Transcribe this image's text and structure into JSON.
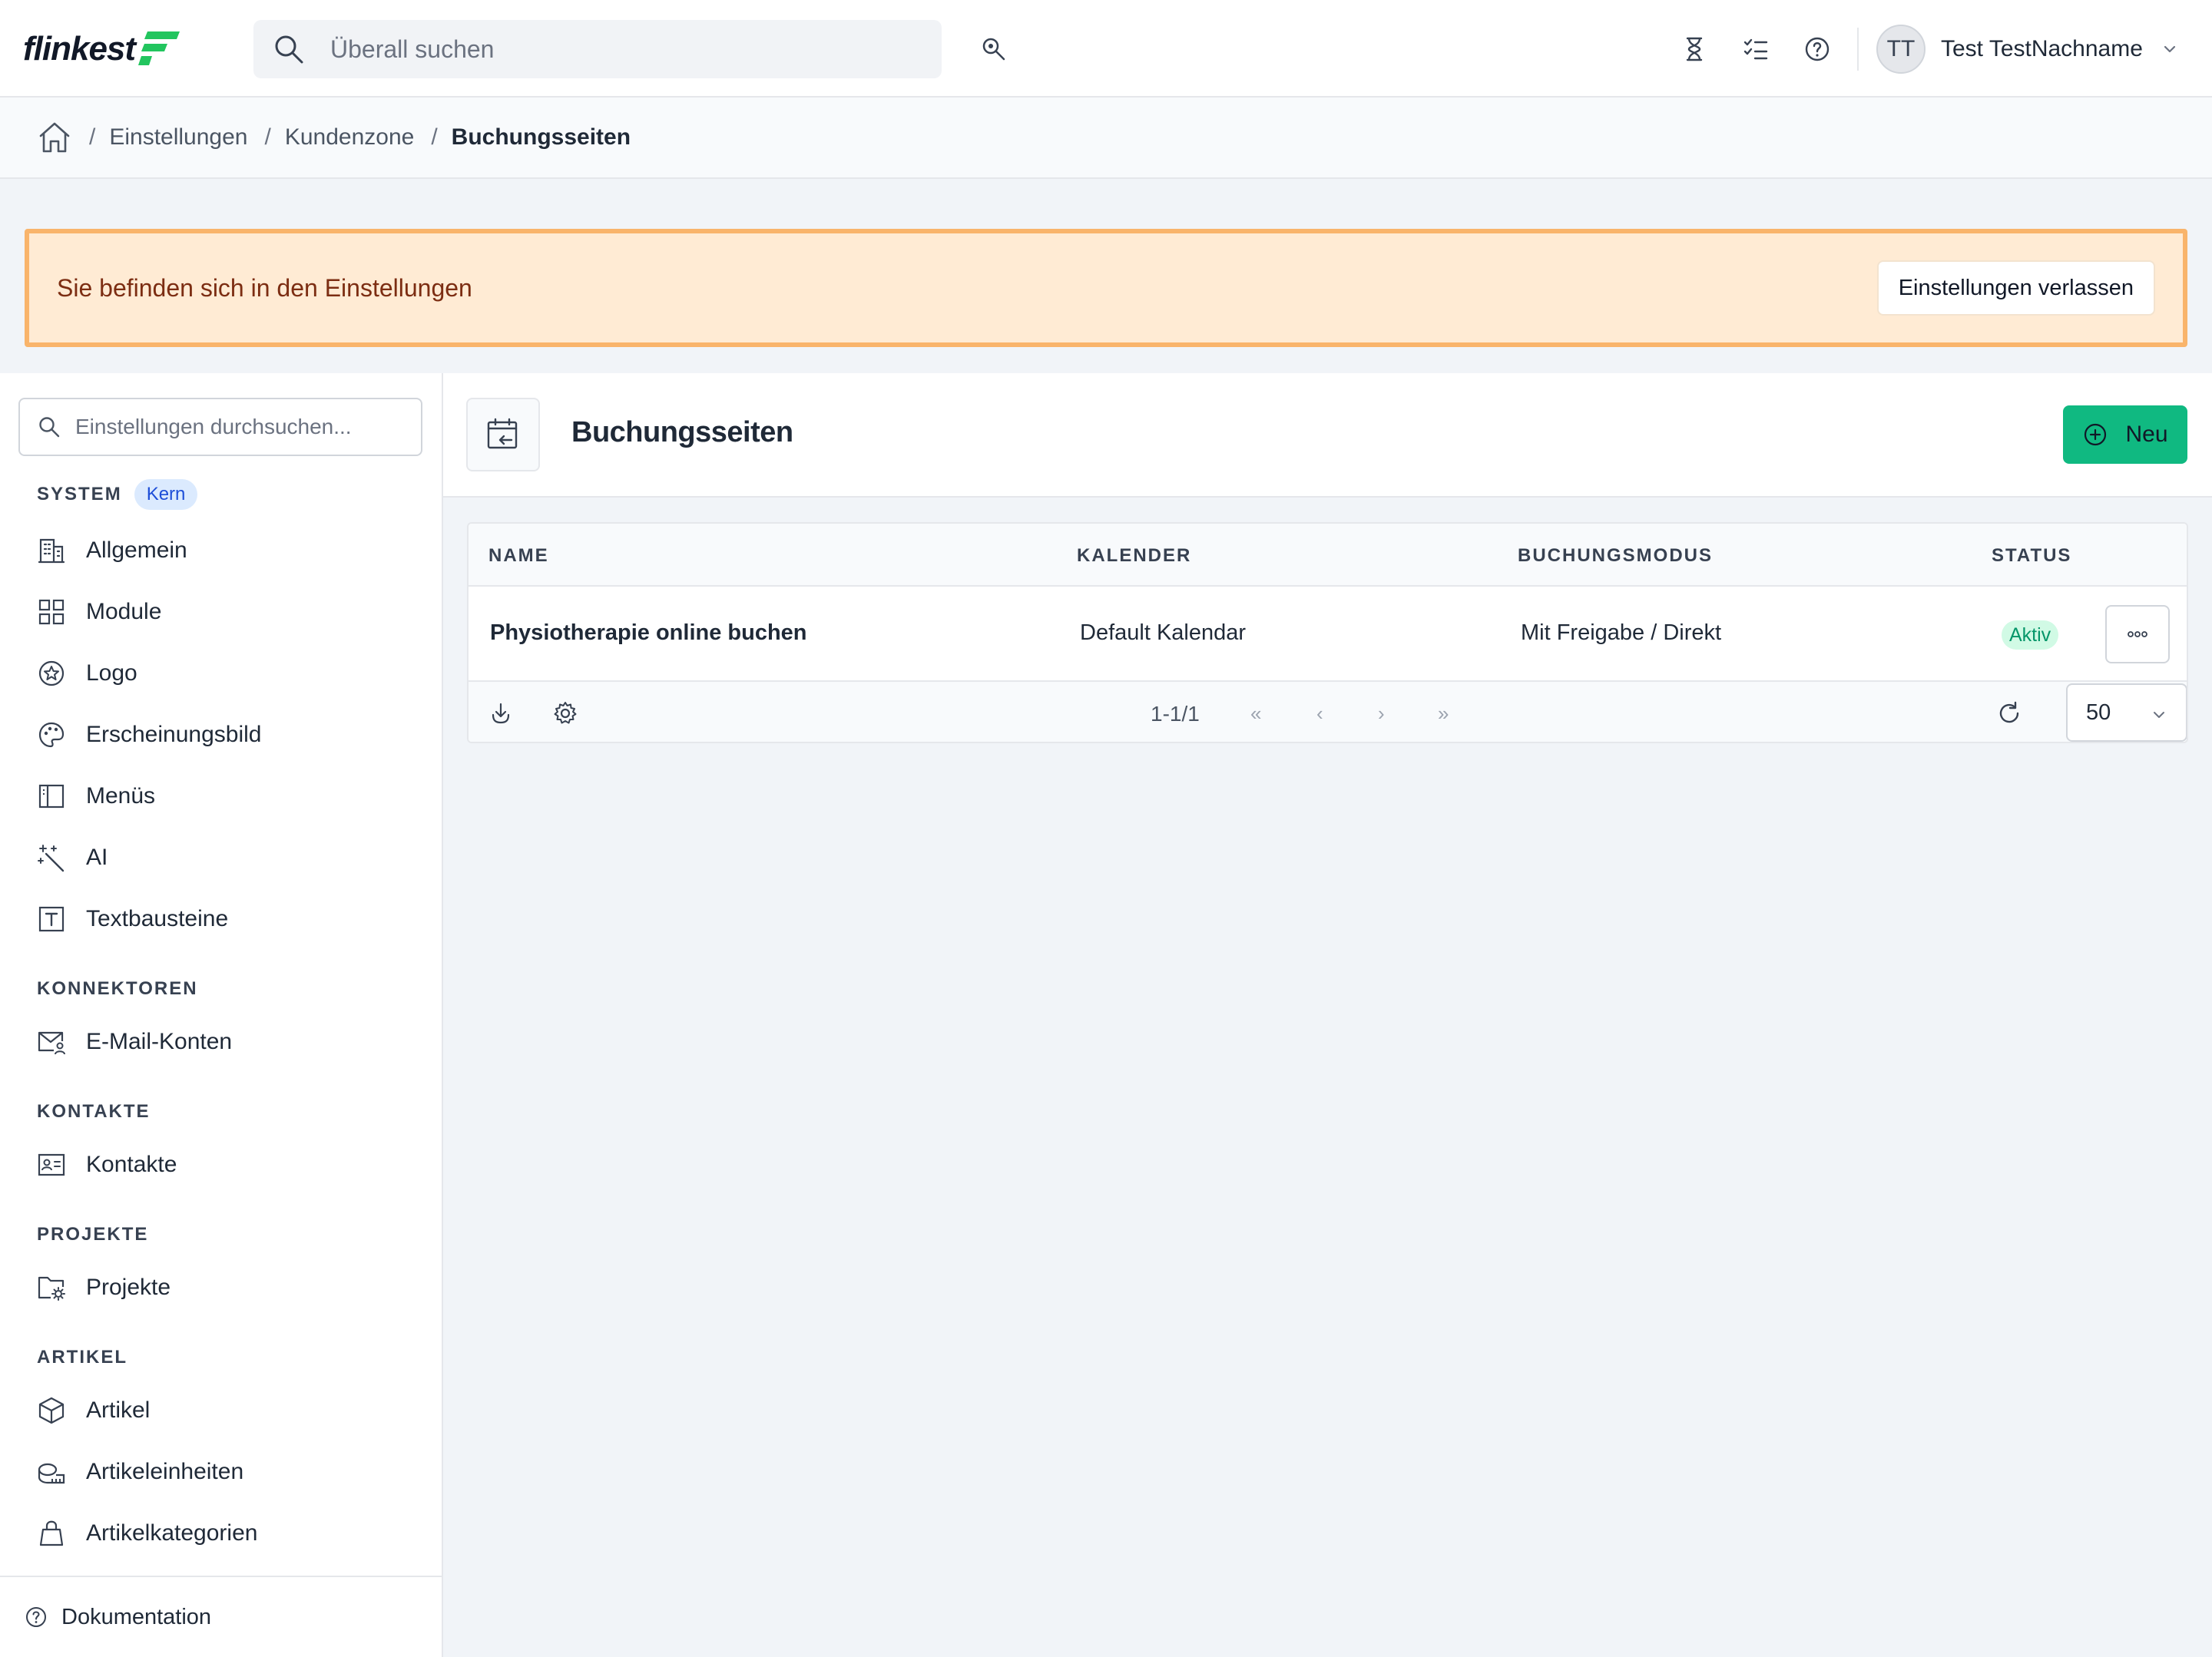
{
  "app": {
    "logo_text": "flinkest",
    "brand_color": "#22c55e"
  },
  "topbar": {
    "search_placeholder": "Überall suchen",
    "icons": [
      "search-icon",
      "advanced-search-icon",
      "hourglass-icon",
      "tasks-icon",
      "help-icon",
      "chevron-down-icon"
    ],
    "user": {
      "initials": "TT",
      "name": "Test TestNachname"
    }
  },
  "breadcrumb": {
    "items": [
      "Einstellungen",
      "Kundenzone",
      "Buchungsseiten"
    ]
  },
  "banner": {
    "text": "Sie befinden sich in den Einstellungen",
    "button_label": "Einstellungen verlassen",
    "bg_color": "#ffebd4",
    "border_color": "#f9b46b"
  },
  "sidebar": {
    "search_placeholder": "Einstellungen durchsuchen...",
    "sections": [
      {
        "title": "SYSTEM",
        "badge": "Kern",
        "items": [
          {
            "label": "Allgemein",
            "icon": "building-icon"
          },
          {
            "label": "Module",
            "icon": "grid-icon"
          },
          {
            "label": "Logo",
            "icon": "star-badge-icon"
          },
          {
            "label": "Erscheinungsbild",
            "icon": "palette-icon"
          },
          {
            "label": "Menüs",
            "icon": "sidebar-layout-icon"
          },
          {
            "label": "AI",
            "icon": "magic-wand-icon"
          },
          {
            "label": "Textbausteine",
            "icon": "text-box-icon"
          }
        ]
      },
      {
        "title": "KONNEKTOREN",
        "items": [
          {
            "label": "E-Mail-Konten",
            "icon": "mail-user-icon"
          }
        ]
      },
      {
        "title": "KONTAKTE",
        "items": [
          {
            "label": "Kontakte",
            "icon": "contact-card-icon"
          }
        ]
      },
      {
        "title": "PROJEKTE",
        "items": [
          {
            "label": "Projekte",
            "icon": "folder-gear-icon"
          }
        ]
      },
      {
        "title": "ARTIKEL",
        "items": [
          {
            "label": "Artikel",
            "icon": "cube-icon"
          },
          {
            "label": "Artikeleinheiten",
            "icon": "ruler-icon"
          },
          {
            "label": "Artikelkategorien",
            "icon": "shopping-bag-icon"
          }
        ]
      }
    ],
    "footer_label": "Dokumentation"
  },
  "main": {
    "title": "Buchungsseiten",
    "new_button_label": "Neu",
    "table": {
      "columns": [
        "NAME",
        "KALENDER",
        "BUCHUNGSMODUS",
        "STATUS"
      ],
      "rows": [
        {
          "name": "Physiotherapie online buchen",
          "kalender": "Default Kalendar",
          "buchungsmodus": "Mit Freigabe / Direkt",
          "status": "Aktiv"
        }
      ],
      "pagination": {
        "range": "1-1/1",
        "first": "«",
        "prev": "‹",
        "next": "›",
        "last": "»",
        "per_page": "50"
      }
    }
  }
}
